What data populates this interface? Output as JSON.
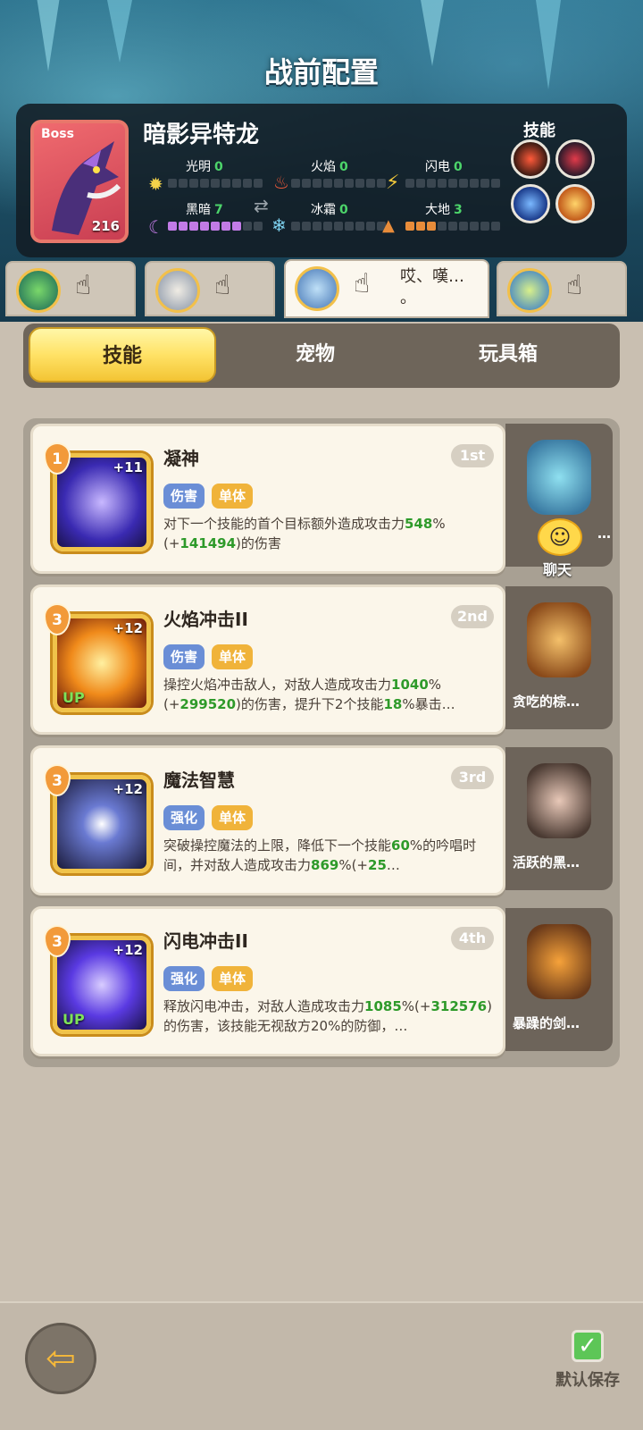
{
  "title": "战前配置",
  "boss": {
    "tag": "Boss",
    "name": "暗影异特龙",
    "level": "216",
    "elements": [
      {
        "name": "光明",
        "value": "0",
        "icon": "sun-icon",
        "filled": 0,
        "color": "#f4d34a"
      },
      {
        "name": "火焰",
        "value": "0",
        "icon": "fire-icon",
        "filled": 0,
        "color": "#ef5a3a"
      },
      {
        "name": "闪电",
        "value": "0",
        "icon": "lightning-icon",
        "filled": 0,
        "color": "#f3c93a"
      },
      {
        "name": "黑暗",
        "value": "7",
        "icon": "moon-icon",
        "filled": 7,
        "color": "#c27be6"
      },
      {
        "name": "冰霜",
        "value": "0",
        "icon": "snowflake-icon",
        "filled": 0,
        "color": "#7fd4f2"
      },
      {
        "name": "大地",
        "value": "3",
        "icon": "earth-icon",
        "filled": 3,
        "color": "#e88c3a"
      }
    ],
    "skills_label": "技能",
    "skill_icons": [
      "bite-icon",
      "dragon-head-icon",
      "lightning-orb-icon",
      "claw-icon"
    ]
  },
  "heroes": [
    {
      "name": "hero-1",
      "avatar": "green-creature-avatar"
    },
    {
      "name": "hero-2",
      "avatar": "silver-hair-avatar"
    },
    {
      "name": "hero-3",
      "avatar": "blue-hair-avatar",
      "speech": "哎、嘆…\n。"
    },
    {
      "name": "hero-4",
      "avatar": "green-fairy-avatar"
    }
  ],
  "tabs": [
    "技能",
    "宠物",
    "玩具箱"
  ],
  "skills": [
    {
      "badge": "1",
      "level": "+11",
      "up": "",
      "name": "凝神",
      "order": "1st",
      "tags": [
        "伤害",
        "单体"
      ],
      "desc": [
        "对下一个技能的首个目标额外造成攻击力",
        "548",
        "%(+",
        "141494",
        ")的伤害"
      ]
    },
    {
      "badge": "3",
      "level": "+12",
      "up": "UP",
      "name": "火焰冲击II",
      "order": "2nd",
      "tags": [
        "伤害",
        "单体"
      ],
      "desc": [
        "操控火焰冲击敌人，对敌人造成攻击力",
        "1040",
        "%(+",
        "299520",
        ")的伤害，提升下2个技能",
        "18",
        "%暴击…"
      ]
    },
    {
      "badge": "3",
      "level": "+12",
      "up": "",
      "name": "魔法智慧",
      "order": "3rd",
      "tags": [
        "强化",
        "单体"
      ],
      "desc": [
        "突破操控魔法的上限，降低下一个技能",
        "60",
        "%的吟唱时间，并对敌人造成攻击力",
        "869",
        "%(+",
        "25",
        "…"
      ]
    },
    {
      "badge": "3",
      "level": "+12",
      "up": "UP",
      "name": "闪电冲击II",
      "order": "4th",
      "tags": [
        "强化",
        "单体"
      ],
      "desc": [
        "释放闪电冲击，对敌人造成攻击力",
        "1085",
        "%(+",
        "312576",
        ")的伤害，该技能无视敌方20%的防御，…"
      ]
    }
  ],
  "pets": [
    {
      "name": "…",
      "chat": "聊天"
    },
    {
      "name": "贪吃的棕…"
    },
    {
      "name": "活跃的黑…"
    },
    {
      "name": "暴躁的剑…"
    }
  ],
  "footer": {
    "save_label": "默认保存"
  }
}
